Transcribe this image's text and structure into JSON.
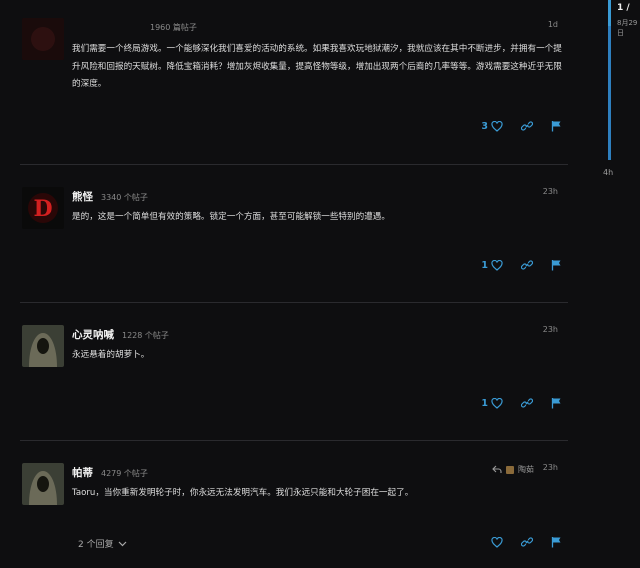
{
  "posts": [
    {
      "username": "",
      "post_count": "1960 篇帖子",
      "date": "1d",
      "body": "我们需要一个终局游戏。一个能够深化我们喜爱的活动的系统。如果我喜欢玩地狱潮汐，我就应该在其中不断进步，并拥有一个提升风险和回报的天赋树。降低宝箱消耗？增加灰烬收集量，提高怪物等级，增加出现两个后裔的几率等等。游戏需要这种近乎无限的深度。",
      "likes": "3"
    },
    {
      "username": "熊怪",
      "post_count": "3340 个帖子",
      "date": "23h",
      "body": "是的，这是一个简单但有效的策略。锁定一个方面，甚至可能解锁一些特别的遭遇。",
      "likes": "1"
    },
    {
      "username": "心灵呐喊",
      "post_count": "1228 个帖子",
      "date": "23h",
      "body": "永远悬着的胡萝卜。",
      "likes": "1"
    },
    {
      "username": "帕蒂",
      "post_count": "4279 个帖子",
      "date": "23h",
      "reply_to": "陶茹",
      "body": "Taoru，当你重新发明轮子时，你永远无法发明汽车。我们永远只能和大轮子困在一起了。",
      "likes": "",
      "replies": "2 个回复"
    }
  ],
  "timeline": {
    "position": "1 /",
    "date": "8月29日",
    "end_label": "4h"
  },
  "colors": {
    "accent": "#3a9bd5",
    "background": "#0e0e10",
    "divider": "#2a2a2e"
  },
  "icons": [
    "heart-icon",
    "link-icon",
    "flag-icon",
    "reply-arrow-icon",
    "chevron-down-icon"
  ]
}
